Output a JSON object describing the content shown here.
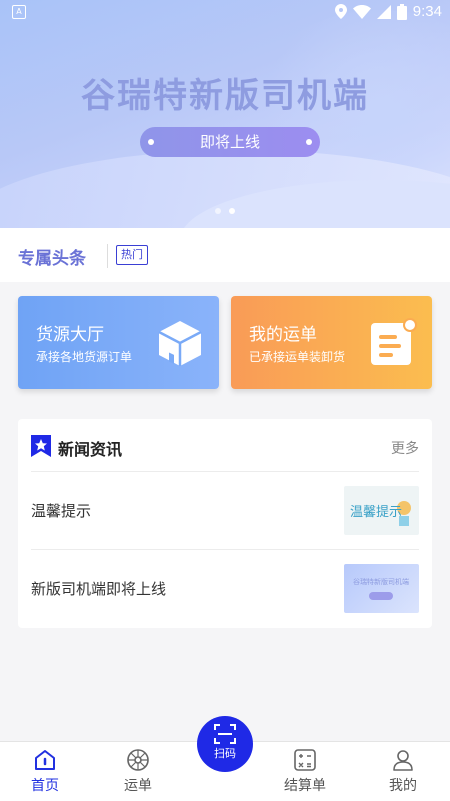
{
  "status_bar": {
    "time": "9:34",
    "notification_icon": "a-square-icon"
  },
  "banner": {
    "title": "谷瑞特新版司机端",
    "pill_text": "即将上线",
    "page_dots": 2,
    "active_dot": 1
  },
  "headline": {
    "label": "专属头条",
    "tag": "热门"
  },
  "cards": [
    {
      "title": "货源大厅",
      "subtitle": "承接各地货源订单",
      "icon": "box-icon"
    },
    {
      "title": "我的运单",
      "subtitle": "已承接运单装卸货",
      "icon": "document-icon"
    }
  ],
  "news": {
    "title": "新闻资讯",
    "more": "更多",
    "items": [
      {
        "title": "温馨提示",
        "thumb_text": "温馨提示"
      },
      {
        "title": "新版司机端即将上线",
        "thumb_text": "谷瑞特新版司机端"
      }
    ]
  },
  "tabs": [
    {
      "label": "首页",
      "icon": "home-icon",
      "active": true
    },
    {
      "label": "运单",
      "icon": "wheel-icon",
      "active": false
    },
    {
      "label": "扫码",
      "icon": "scan-icon",
      "active": false
    },
    {
      "label": "结算单",
      "icon": "calculator-icon",
      "active": false
    },
    {
      "label": "我的",
      "icon": "user-icon",
      "active": false
    }
  ],
  "colors": {
    "primary": "#1f29e6",
    "headline": "#6a72d6",
    "card_blue": "#7aaaf7",
    "card_orange": "#fbac52"
  }
}
